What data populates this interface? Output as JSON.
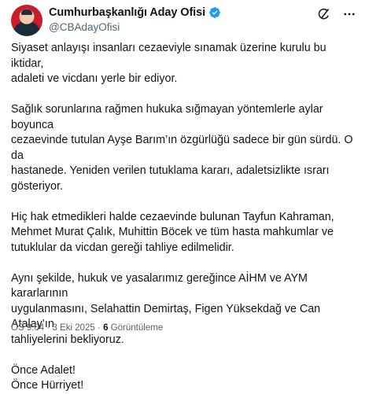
{
  "author": {
    "display_name": "Cumhurbaşkanlığı Aday Ofisi",
    "handle": "@CBAdayOfisi",
    "verified_badge_color": "#1d9bf0",
    "avatar_bg": "#c81e2a"
  },
  "header_icons": [
    "grok-icon",
    "more-icon"
  ],
  "tweet": {
    "paragraphs": [
      [
        "Siyaset anlayışı insanları cezaeviyle sınamak üzerine kurulu bu iktidar,",
        "adaleti ve vicdanı yerle bir ediyor."
      ],
      [
        "Sağlık sorunlarına rağmen hukuka sığmayan yöntemlerle aylar boyunca",
        "cezaevinde tutulan Ayşe Barım’ın özgürlüğü sadece bir gün sürdü. O da",
        "hastanede. Yeniden verilen tutuklama kararı, adaletsizlikte ısrarı",
        "gösteriyor."
      ],
      [
        "Hiç hak etmedikleri halde cezaevinde bulunan Tayfun Kahraman,",
        "Mehmet Murat Çalık, Muhittin Böcek ve tüm hasta mahkumlar ve",
        "tutuklular da vicdan gereği tahliye edilmelidir."
      ],
      [
        "Aynı şekilde, hukuk ve yasalarımız gereğince AİHM ve AYM kararlarının",
        "uygulanmasını, Selahattin Demirtaş, Figen Yüksekdağ ve Can Atalay’ın",
        "tahliyelerini bekliyoruz."
      ],
      [
        "Önce Adalet!",
        "Önce Hürriyet!"
      ]
    ]
  },
  "meta": {
    "time": "ÖS 9:04",
    "separator": "·",
    "date": "3 Eki 2025",
    "views_count": "6",
    "views_label": "Görüntüleme"
  }
}
